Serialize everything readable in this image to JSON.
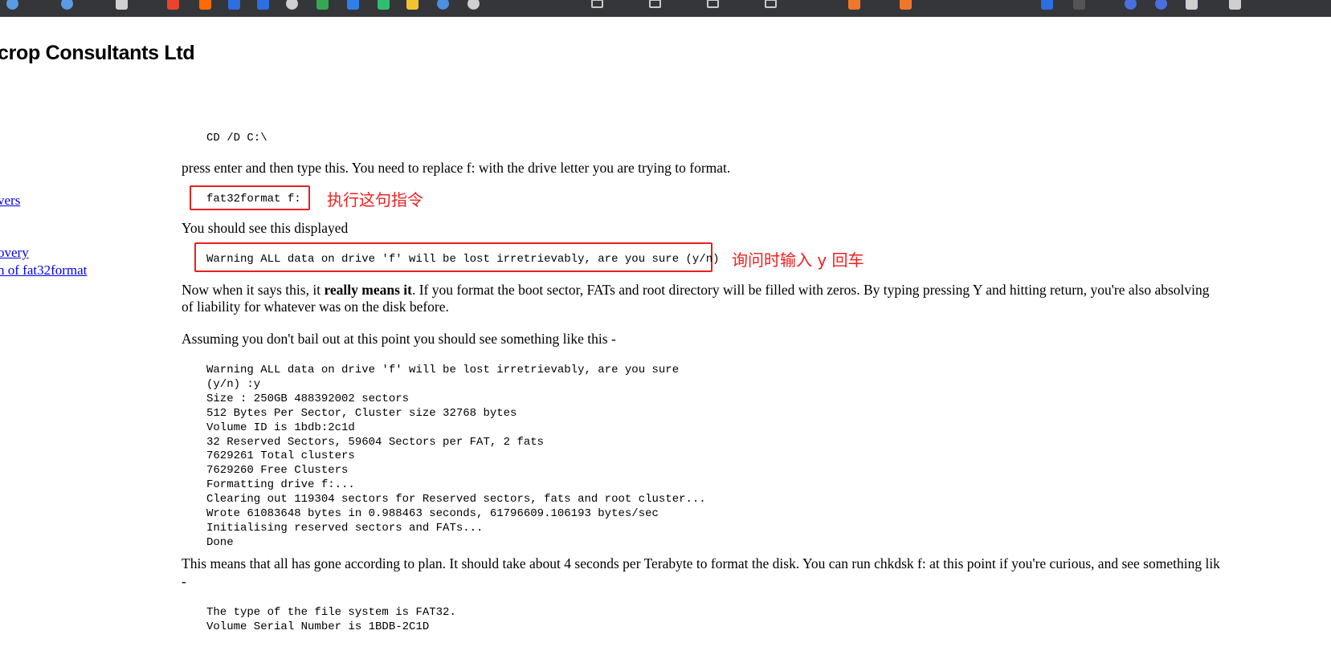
{
  "bookmarks_bar": {
    "items": [
      {
        "icon": "globe-icon",
        "label": "",
        "color": "#5a9be6"
      },
      {
        "icon": "globe-icon",
        "label": "",
        "color": "#5a9be6"
      },
      {
        "icon": "doc-icon",
        "label": "",
        "color": "#d0d0d0"
      },
      {
        "icon": "c-logo-icon",
        "label": "",
        "color": "#e8452c"
      },
      {
        "icon": "square-icon",
        "label": "",
        "color": "#ff6a00"
      },
      {
        "icon": "square-icon",
        "label": "",
        "color": "#2b6fe0"
      },
      {
        "icon": "square-icon",
        "label": "",
        "color": "#2b6fe0"
      },
      {
        "icon": "gear-icon",
        "label": "",
        "color": "#cfcfcf"
      },
      {
        "icon": "maps-icon",
        "label": "",
        "color": "#34a853"
      },
      {
        "icon": "dropbox-icon",
        "label": "",
        "color": "#2f7fe8"
      },
      {
        "icon": "pin-icon",
        "label": "",
        "color": "#2fbf71"
      },
      {
        "icon": "square-icon",
        "label": "",
        "color": "#f2c230"
      },
      {
        "icon": "globe-icon",
        "label": "",
        "color": "#4a8fe0"
      },
      {
        "icon": "history-icon",
        "label": "",
        "color": "#cfcfcf"
      },
      {
        "icon": "folder-icon",
        "label": "",
        "color": "#cfcfcf"
      },
      {
        "icon": "folder-icon",
        "label": "",
        "color": "#cfcfcf"
      },
      {
        "icon": "folder-icon",
        "label": "",
        "color": "#cfcfcf"
      },
      {
        "icon": "folder-icon",
        "label": "",
        "color": "#cfcfcf"
      },
      {
        "icon": "bracket-icon",
        "label": "",
        "color": "#f0772a"
      },
      {
        "icon": "bracket-icon",
        "label": "",
        "color": "#f0772a"
      },
      {
        "icon": "square-icon",
        "label": "",
        "color": "#2b6fe0"
      },
      {
        "icon": "square-icon",
        "label": "",
        "color": "#555555"
      },
      {
        "icon": "globe-icon",
        "label": "",
        "color": "#4a6fe0"
      },
      {
        "icon": "globe-icon",
        "label": "",
        "color": "#4a6fe0"
      },
      {
        "icon": "calendar-icon",
        "label": "",
        "color": "#cfcfcf"
      },
      {
        "icon": "calendar-icon",
        "label": "",
        "color": "#cfcfcf"
      }
    ]
  },
  "site": {
    "title": "crop Consultants Ltd"
  },
  "sidebar": {
    "links": [
      {
        "label": "vers"
      },
      {
        "label": "overy"
      },
      {
        "label": "n of fat32format"
      }
    ]
  },
  "content": {
    "code_cd": "CD /D C:\\",
    "para_press_enter": "press enter and then type this. You need to replace f: with the drive letter you are trying to format.",
    "code_command": "fat32format f:",
    "annotation_command": "执行这句指令",
    "para_should_see": "You should see this displayed",
    "code_warning": "Warning ALL data on drive 'f' will be lost irretrievably, are you sure (y/n)",
    "annotation_warning": "询问时输入 y  回车",
    "para_now_prefix": "Now when it says this, it ",
    "para_now_bold": "really means it",
    "para_now_suffix": ". If you format the boot sector, FATs and root directory will be filled with zeros. By typing pressing Y and hitting return, you're also absolving",
    "para_now_line2": "of liability for whatever was on the disk before.",
    "para_assuming": "Assuming you don't bail out at this point you should see something like this -",
    "code_output": [
      "Warning ALL data on drive 'f' will be lost irretrievably, are you sure",
      "(y/n) :y",
      "Size : 250GB 488392002 sectors",
      "512 Bytes Per Sector, Cluster size 32768 bytes",
      "Volume ID is 1bdb:2c1d",
      "32 Reserved Sectors, 59604 Sectors per FAT, 2 fats",
      "7629261 Total clusters",
      "7629260 Free Clusters",
      "Formatting drive f:...",
      "Clearing out 119304 sectors for Reserved sectors, fats and root cluster...",
      "Wrote 61083648 bytes in 0.988463 seconds, 61796609.106193 bytes/sec",
      "Initialising reserved sectors and FATs...",
      "Done"
    ],
    "para_means_line1": "This means that all has gone according to plan. It should take about 4 seconds per Terabyte to format the disk. You can run chkdsk f: at this point if you're curious, and see something lik",
    "para_means_line2": "-",
    "code_chkdsk": [
      "The type of the file system is FAT32.",
      "Volume Serial Number is 1BDB-2C1D"
    ]
  }
}
